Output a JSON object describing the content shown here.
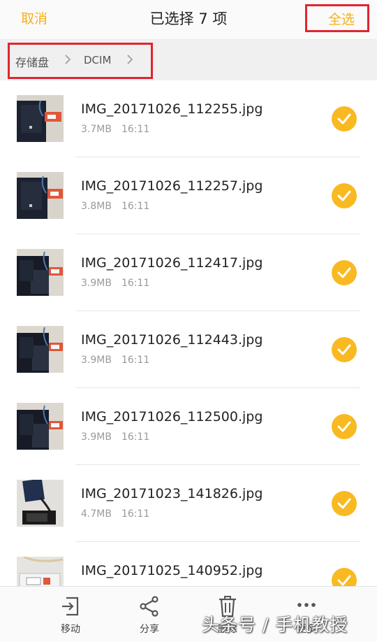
{
  "header": {
    "cancel_label": "取消",
    "title": "已选择 7 项",
    "select_all_label": "全选"
  },
  "breadcrumb": {
    "items": [
      "存储盘",
      "DCIM"
    ]
  },
  "files": [
    {
      "name": "IMG_20171026_112255.jpg",
      "size": "3.7MB",
      "time": "16:11",
      "selected": true
    },
    {
      "name": "IMG_20171026_112257.jpg",
      "size": "3.8MB",
      "time": "16:11",
      "selected": true
    },
    {
      "name": "IMG_20171026_112417.jpg",
      "size": "3.9MB",
      "time": "16:11",
      "selected": true
    },
    {
      "name": "IMG_20171026_112443.jpg",
      "size": "3.9MB",
      "time": "16:11",
      "selected": true
    },
    {
      "name": "IMG_20171026_112500.jpg",
      "size": "3.9MB",
      "time": "16:11",
      "selected": true
    },
    {
      "name": "IMG_20171023_141826.jpg",
      "size": "4.7MB",
      "time": "16:11",
      "selected": true
    },
    {
      "name": "IMG_20171025_140952.jpg",
      "size": "",
      "time": "",
      "selected": true
    }
  ],
  "bottom_actions": {
    "move_label": "移动",
    "share_label": "分享",
    "delete_label": "删除",
    "more_label": "更多"
  },
  "watermark": "头条号 / 手机教授",
  "colors": {
    "accent": "#f5b01a",
    "check": "#f9b921",
    "highlight_box": "#e02530"
  }
}
